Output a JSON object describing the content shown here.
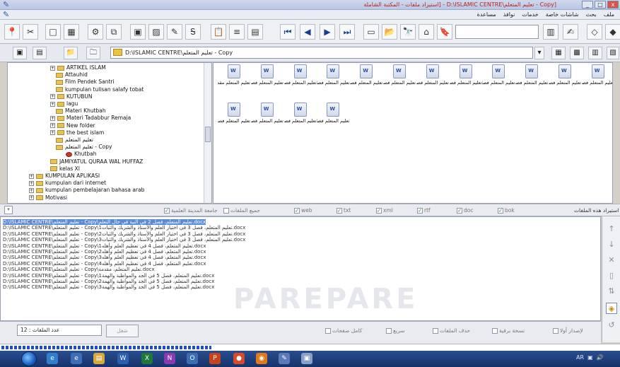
{
  "window": {
    "title": "[Copy - تعليم المتعلم\\D:\\ISLAMIC CENTRE - [استيراد ملفات - المكتبة الشاملة",
    "controls": [
      "_",
      "□",
      "x"
    ]
  },
  "menu": {
    "items": [
      "ملف",
      "بحث",
      "شاشات خاصة",
      "خدمات",
      "نوافذ",
      "مساعدة"
    ]
  },
  "address": {
    "path": "D:\\ISLAMIC CENTRE\\تعليم المتعلم - Copy"
  },
  "tree": {
    "items": [
      {
        "label": "ARTIKEL ISLAM",
        "expandable": true
      },
      {
        "label": "Attauhid",
        "expandable": false
      },
      {
        "label": "Film Pendek Santri",
        "expandable": false
      },
      {
        "label": "kumpulan tulisan salafy tobat",
        "expandable": false
      },
      {
        "label": "KUTUBUN",
        "expandable": true
      },
      {
        "label": "lagu",
        "expandable": true
      },
      {
        "label": "Materi Khutbah",
        "expandable": false
      },
      {
        "label": "Materi Tadabbur Remaja",
        "expandable": true
      },
      {
        "label": "New folder",
        "expandable": true
      },
      {
        "label": "the best islam",
        "expandable": true
      },
      {
        "label": "تعليم المتعلم",
        "expandable": false
      },
      {
        "label": "تعليم المتعلم - Copy",
        "expandable": false
      },
      {
        "label": "Khutbah",
        "expandable": false
      },
      {
        "label": "JAMIYATUL QURAA WAL HUFFAZ",
        "expandable": false
      },
      {
        "label": "kelas XI",
        "expandable": false
      },
      {
        "label": "KUMPULAN APLIKASI",
        "expandable": true
      },
      {
        "label": "kumpulan dari internet",
        "expandable": true
      },
      {
        "label": "kumpulan pembelajaran bahasa arab",
        "expandable": true
      },
      {
        "label": "Motivasi",
        "expandable": true
      }
    ]
  },
  "files": {
    "items": [
      "تعليم المتعلم مقدمة",
      "تعليم المتعلم فصل 1 في م",
      "تعليم المتعلم فصل 1 في م",
      "تعليم المتعلم فصل 1 في م",
      "تعليم المتعلم فصل 2 في",
      "تعليم المتعلم فصل 2 في",
      "تعليم المتعلم فصل 3 في",
      "تعليم المتعلم فصل 3 في",
      "تعليم المتعلم فصل 3 في",
      "تعليم المتعلم فصل 4 في",
      "تعليم المتعلم فصل 4 في",
      "تعليم المتعلم فصل 4 في",
      "تعليم المتعلم فصل 4 في",
      "تعليم المتعلم فصل 5 في ا",
      "تعليم المتعلم فصل 5 في ا",
      "تعليم المتعلم فصل 5 في ا"
    ]
  },
  "filters": {
    "left_label": "جامعة المدينة العلمية",
    "all_files": "جميع الملفات",
    "types": [
      "web",
      "txt",
      "xml",
      "rtf",
      "doc",
      "bok"
    ],
    "right_label": "استيراد هذه الملفات"
  },
  "results": {
    "lines": [
      "D:\\ISLAMIC CENTRE\\تعليم المتعلم - Copy\\تعليم المتعلم، فصل 2 في النية في حال التعلم.docx",
      "D:\\ISLAMIC CENTRE\\تعليم المتعلم - Copy\\تعليم المتعلم، فصل 3 في اختيار العلم والأستاذ والشريك والثبات1.docx",
      "D:\\ISLAMIC CENTRE\\تعليم المتعلم - Copy\\تعليم المتعلم، فصل 3 في اختيار العلم والأستاذ والشريك والثبات2.docx",
      "D:\\ISLAMIC CENTRE\\تعليم المتعلم - Copy\\تعليم المتعلم، فصل 3 في اختيار العلم والأستاذ والشريك والثبات3.docx",
      "D:\\ISLAMIC CENTRE\\تعليم المتعلم - Copy\\تعليم المتعلم، فصل 4 في تعظيم العلم وأهله1.docx",
      "D:\\ISLAMIC CENTRE\\تعليم المتعلم - Copy\\تعليم المتعلم، فصل 4 في تعظيم العلم وأهله2.docx",
      "D:\\ISLAMIC CENTRE\\تعليم المتعلم - Copy\\تعليم المتعلم، فصل 4 في تعظيم العلم وأهله3.docx",
      "D:\\ISLAMIC CENTRE\\تعليم المتعلم - Copy\\تعليم المتعلم، فصل 4 في تعظيم العلم وأهله4.docx",
      "D:\\ISLAMIC CENTRE\\تعليم المتعلم - Copy\\تعليم المتعلم، مقدمة.docx",
      "D:\\ISLAMIC CENTRE\\تعليم المتعلم - Copy\\تعليم المتعلم، فصل 5 في الجد والمواظبة والهمة1.docx",
      "D:\\ISLAMIC CENTRE\\تعليم المتعلم - Copy\\تعليم المتعلم، فصل 5 في الجد والمواظبة والهمة2.docx",
      "D:\\ISLAMIC CENTRE\\تعليم المتعلم - Copy\\تعليم المتعلم، فصل 5 في الجد والمواظبة والهمة3.docx"
    ]
  },
  "bottom": {
    "count_label": "عدد الملفات : 12",
    "search_button": "شغل",
    "options": [
      "كامل صفحات",
      "سريع",
      "حذف الملفات",
      "نسخة برقية",
      "لإصدار أولا"
    ]
  },
  "progress": {
    "fraction": 0.34
  },
  "watermark": "PAREPARE",
  "taskbar": {
    "tray": "AR",
    "apps": [
      "ie",
      "folder",
      "word",
      "excel",
      "ppt",
      "chrome",
      "firefox",
      "app",
      "shamela"
    ]
  }
}
